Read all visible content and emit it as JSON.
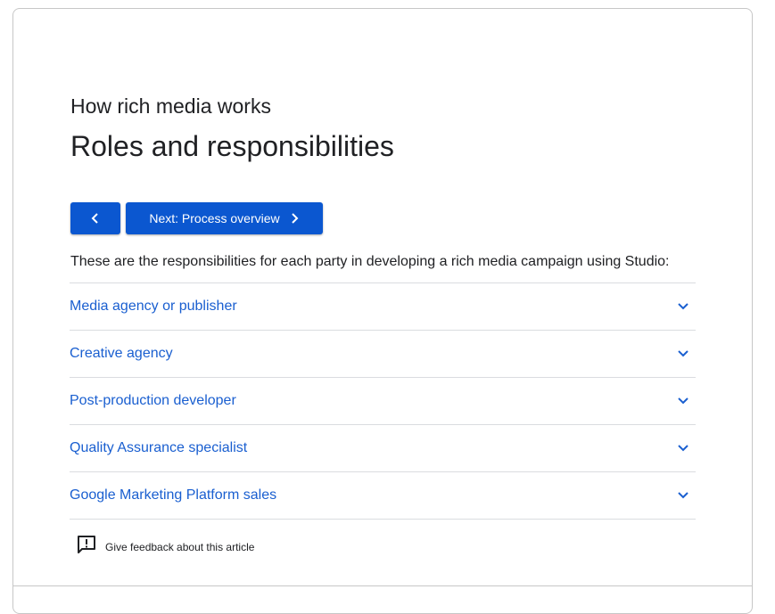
{
  "article": {
    "breadcrumb": "How rich media works",
    "title": "Roles and responsibilities",
    "intro": "These are the responsibilities for each party in developing a rich media campaign using Studio:"
  },
  "navigation": {
    "prev_icon": "chevron-left-icon",
    "next_label": "Next: Process overview",
    "next_icon": "chevron-right-icon"
  },
  "accordion": {
    "items": [
      {
        "label": "Media agency or publisher",
        "icon": "chevron-down-icon"
      },
      {
        "label": "Creative agency",
        "icon": "chevron-down-icon"
      },
      {
        "label": "Post-production developer",
        "icon": "chevron-down-icon"
      },
      {
        "label": "Quality Assurance specialist",
        "icon": "chevron-down-icon"
      },
      {
        "label": "Google Marketing Platform sales",
        "icon": "chevron-down-icon"
      }
    ]
  },
  "feedback": {
    "label": "Give feedback about this article",
    "icon": "feedback-icon"
  },
  "colors": {
    "accent": "#0b57d0",
    "link": "#1a5fd0",
    "text": "#202124",
    "divider": "#dadce0",
    "border": "#c7c7c7"
  }
}
